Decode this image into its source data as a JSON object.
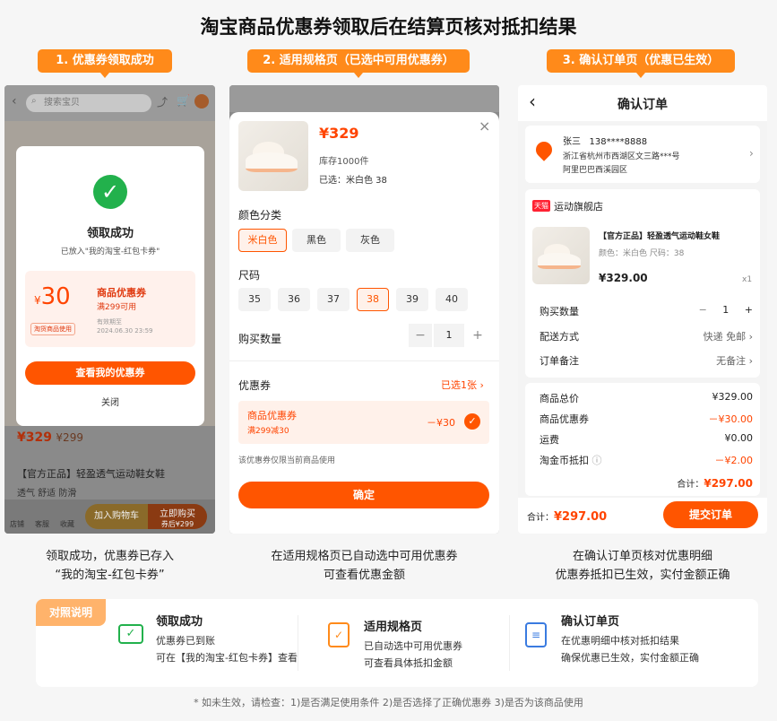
{
  "title": "淘宝商品优惠券领取后在结算页核对抵扣结果",
  "steps": [
    "1. 优惠券领取成功",
    "2. 适用规格页（已选中可用优惠券）",
    "3. 确认订单页（优惠已生效）"
  ],
  "p1": {
    "search": "搜索宝贝",
    "success_title": "领取成功",
    "success_sub": "已放入\"我的淘宝-红包卡券\"",
    "amount": "30",
    "currency": "¥",
    "coupon_name": "商品优惠券",
    "coupon_cond": "满299可用",
    "coupon_tag": "淘货商品使用",
    "valid_label": "有效期至",
    "valid_date": "2024.06.30 23:59",
    "btn_view": "查看我的优惠券",
    "btn_close": "关闭",
    "bg_price": "¥329",
    "bg_price2": "¥299",
    "bg_title": "【官方正品】轻盈透气运动鞋女鞋",
    "bg_tags": "透气 舒适 防滑",
    "bg_cart": "加入购物车",
    "bg_buy": "立即购买",
    "bg_buy_sub": "券后¥299",
    "bg_nav": [
      "店铺",
      "客服",
      "收藏"
    ]
  },
  "p2": {
    "price": "¥329",
    "stock": "库存1000件",
    "selected": "已选：米白色 38",
    "color_label": "颜色分类",
    "colors": [
      "米白色",
      "黑色",
      "灰色"
    ],
    "size_label": "尺码",
    "sizes": [
      "35",
      "36",
      "37",
      "38",
      "39",
      "40"
    ],
    "qty_label": "购买数量",
    "qty": "1",
    "coupon_label": "优惠券",
    "coupon_selected": "已选1张 ›",
    "coupon_name": "商品优惠券",
    "coupon_cond": "满299减30",
    "coupon_amount": "－¥30",
    "note": "该优惠券仅限当前商品使用",
    "btn": "确定"
  },
  "p3": {
    "header": "确认订单",
    "name": "张三",
    "phone": "138****8888",
    "addr1": "浙江省杭州市西湖区文三路***号",
    "addr2": "阿里巴巴西溪园区",
    "shop_badge": "天猫",
    "shop": "运动旗舰店",
    "product": "【官方正品】轻盈透气运动鞋女鞋",
    "spec": "颜色：米白色  尺码：38",
    "price": "¥329.00",
    "count": "x1",
    "qty_label": "购买数量",
    "qty": "1",
    "ship_label": "配送方式",
    "ship_val": "快递 免邮 ›",
    "remark_label": "订单备注",
    "remark_val": "无备注 ›",
    "sum_rows": [
      {
        "k": "商品总价",
        "v": "¥329.00",
        "red": false
      },
      {
        "k": "商品优惠券",
        "v": "－¥30.00",
        "red": true
      },
      {
        "k": "运费",
        "v": "¥0.00",
        "red": false
      },
      {
        "k": "淘金币抵扣",
        "v": "－¥2.00",
        "red": true
      }
    ],
    "total_label": "合计：",
    "total": "¥297.00",
    "footer_label": "合计：",
    "footer_total": "¥297.00",
    "submit": "提交订单"
  },
  "captions": [
    [
      "领取成功，优惠券已存入",
      "“我的淘宝-红包卡券”"
    ],
    [
      "在适用规格页已自动选中可用优惠券",
      "可查看优惠金额"
    ],
    [
      "在确认订单页核对优惠明细",
      "优惠券抵扣已生效，实付金额正确"
    ]
  ],
  "legend": {
    "tag": "对照说明",
    "items": [
      {
        "h": "领取成功",
        "l1": "优惠券已到账",
        "l2": "可在【我的淘宝-红包卡券】查看"
      },
      {
        "h": "适用规格页",
        "l1": "已自动选中可用优惠券",
        "l2": "可查看具体抵扣金额"
      },
      {
        "h": "确认订单页",
        "l1": "在优惠明细中核对抵扣结果",
        "l2": "确保优惠已生效，实付金额正确"
      }
    ]
  },
  "footnote": "* 如未生效，请检查：1)是否满足使用条件 2)是否选择了正确优惠券 3)是否为该商品使用",
  "colors": {
    "accent": "#ff5500",
    "step": "#ff8a1a",
    "success": "#22b14c"
  }
}
